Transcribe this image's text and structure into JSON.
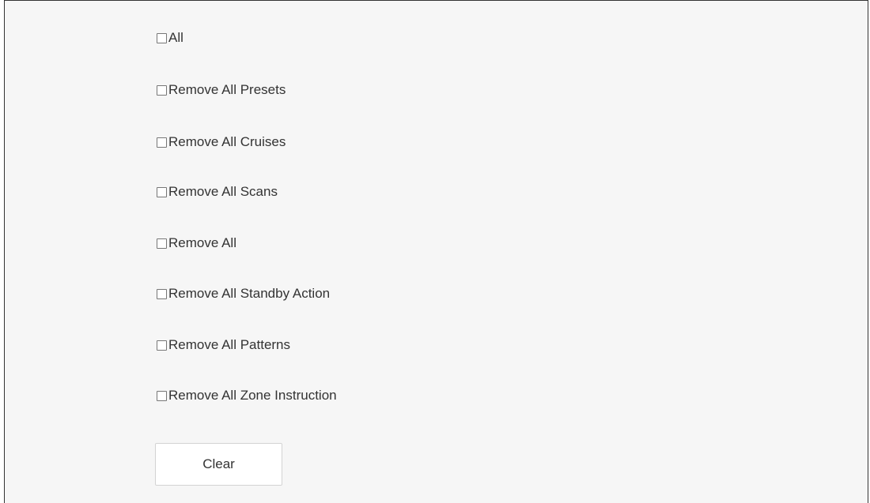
{
  "options": [
    {
      "label": "All",
      "checked": false
    },
    {
      "label": "Remove All Presets",
      "checked": false
    },
    {
      "label": "Remove All Cruises",
      "checked": false
    },
    {
      "label": "Remove All Scans",
      "checked": false
    },
    {
      "label": "Remove All",
      "checked": false
    },
    {
      "label": "Remove All Standby Action",
      "checked": false
    },
    {
      "label": "Remove All Patterns",
      "checked": false
    },
    {
      "label": "Remove All Zone Instruction",
      "checked": false
    }
  ],
  "clear_button": {
    "label": "Clear"
  }
}
